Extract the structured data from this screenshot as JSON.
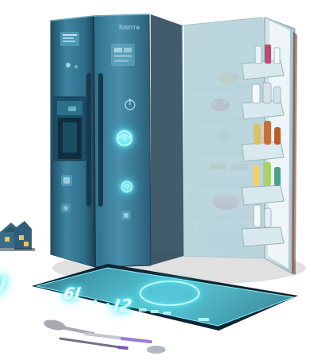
{
  "scene": {
    "subject": "smart-refrigerator-illustration",
    "brand_mark": "fosrrra",
    "tablet_readouts": {
      "left": "I3J",
      "center": "6I",
      "right": "I2"
    },
    "icons": [
      "smart-dial-icon",
      "touch-button-icon",
      "power-icon",
      "ice-dispenser-icon",
      "small-house-icon",
      "spoon-icon",
      "pen-icon"
    ],
    "colors": {
      "fridge_body": "#3c7d97",
      "fridge_edge": "#254e66",
      "interior": "#eaf3f5",
      "shelf_glass": "#c7dfe6",
      "tablet_screen": "#4cc5d8",
      "tablet_glow": "#8ff8ff",
      "tablet_frame": "#143749",
      "floor_shadow": "#2b2b2b"
    }
  }
}
